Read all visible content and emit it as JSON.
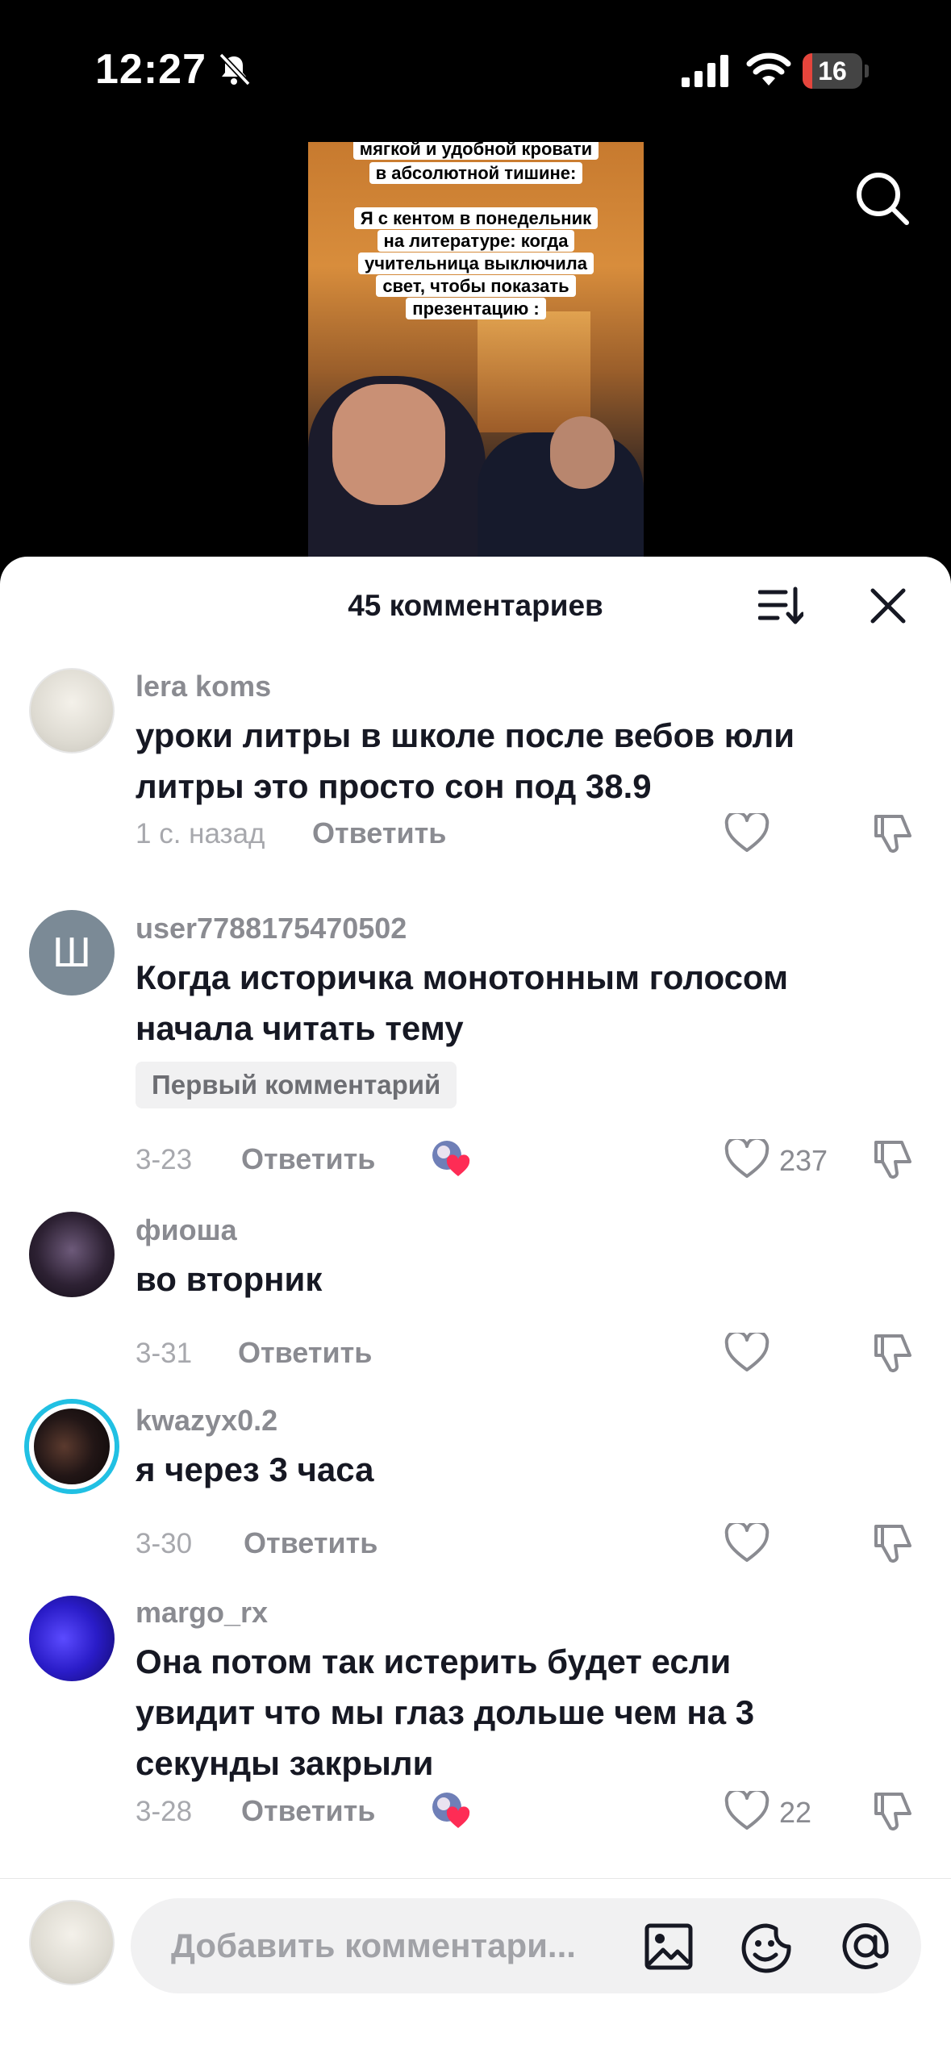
{
  "status_bar": {
    "time": "12:27",
    "battery": "16",
    "battery_level": 0.16
  },
  "video": {
    "caption": [
      "мягкой и удобной кровати",
      "в абсолютной тишине:",
      "Я с кентом в понедельник",
      "на литературе: когда",
      "учительница выключила",
      "свет, чтобы показать",
      "презентацию :"
    ]
  },
  "sheet": {
    "title": "45 комментариев"
  },
  "comments": [
    {
      "username": "lera koms",
      "text_lines": [
        "уроки литры в школе после вебов юли",
        "литры это просто сон под 38.9"
      ],
      "date": "1 с. назад",
      "reply": "Ответить",
      "likes": ""
    },
    {
      "avatar_letter": "Ш",
      "username": "user7788175470502",
      "text_lines": [
        "Когда историчка монотонным голосом",
        "начала читать тему"
      ],
      "badge": "Первый комментарий",
      "date": "3-23",
      "reply": "Ответить",
      "likes": "237"
    },
    {
      "username": "фиоша",
      "text_lines": [
        "во вторник"
      ],
      "date": "3-31",
      "reply": "Ответить",
      "likes": ""
    },
    {
      "username": "kwazyx0.2",
      "text_lines": [
        "я через 3 часа"
      ],
      "date": "3-30",
      "reply": "Ответить",
      "likes": ""
    },
    {
      "username": "margo_rx",
      "text_lines": [
        "Она потом так истерить будет если",
        "увидит что мы глаз дольше чем на 3",
        "секунды закрыли"
      ],
      "date": "3-28",
      "reply": "Ответить",
      "likes": "22"
    }
  ],
  "input": {
    "placeholder": "Добавить комментари..."
  },
  "colors": {
    "accent_ring": "#21c0e3",
    "battery_red": "#e5453c",
    "text_primary": "#161823",
    "text_secondary": "#8a8b91"
  }
}
